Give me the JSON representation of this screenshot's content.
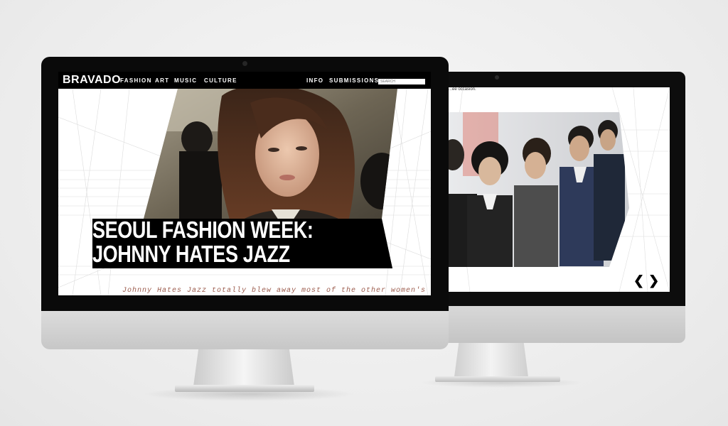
{
  "front_site": {
    "logo": "BRAVADO",
    "nav_left": [
      "FASHION",
      "ART",
      "MUSIC",
      "CULTURE"
    ],
    "nav_right": [
      "INFO",
      "SUBMISSIONS"
    ],
    "search_placeholder": "SEARCH",
    "headline_line1": "SEOUL FASHION WEEK:",
    "headline_line2": "JOHNNY HATES JAZZ",
    "dek": "Johnny Hates Jazz totally blew away most of the other women's"
  },
  "back_site": {
    "cut_text": "...ee occasion.",
    "prev_arrow": "❮",
    "next_arrow": "❯"
  }
}
